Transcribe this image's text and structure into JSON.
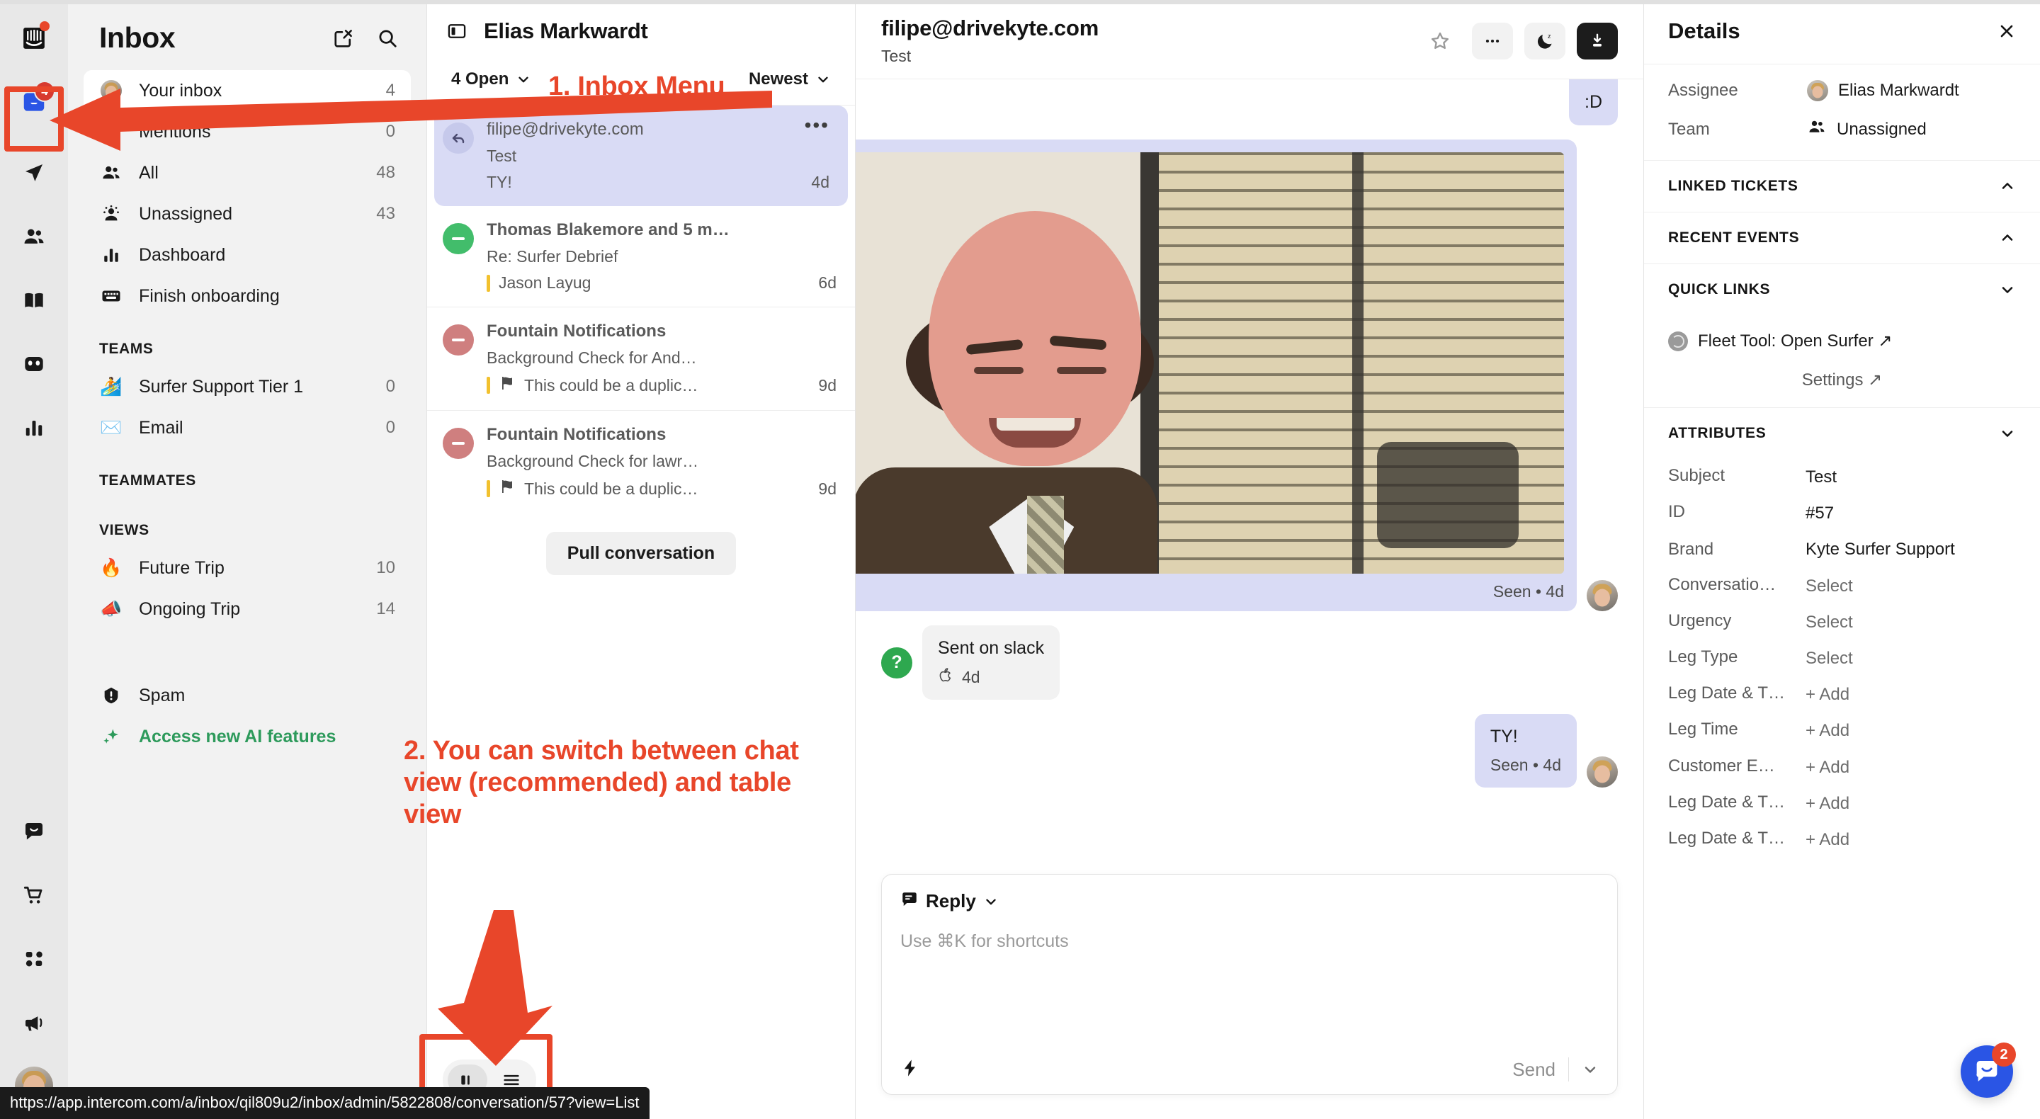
{
  "rail": {
    "icons": [
      {
        "name": "intercom-logo-icon",
        "badge": null,
        "dot": true
      },
      {
        "name": "inbox-icon",
        "badge": "4",
        "active": true
      },
      {
        "name": "send-outbound-icon",
        "badge": null
      },
      {
        "name": "contacts-icon",
        "badge": null
      },
      {
        "name": "knowledge-book-icon",
        "badge": null
      },
      {
        "name": "fin-ai-icon",
        "badge": null
      },
      {
        "name": "reports-bar-chart-icon",
        "badge": null
      },
      {
        "name": "messenger-chat-icon",
        "badge": null
      },
      {
        "name": "commerce-cart-icon",
        "badge": null
      },
      {
        "name": "apps-grid-icon",
        "badge": null
      },
      {
        "name": "news-megaphone-icon",
        "badge": null
      }
    ]
  },
  "nav": {
    "title": "Inbox",
    "compose_icon": "compose-icon",
    "search_icon": "search-icon",
    "items": [
      {
        "label": "Your inbox",
        "count": "4",
        "icon": "avatar",
        "active": true
      },
      {
        "label": "Mentions",
        "count": "0",
        "icon": "at-icon"
      },
      {
        "label": "All",
        "count": "48",
        "icon": "people-icon"
      },
      {
        "label": "Unassigned",
        "count": "43",
        "icon": "unassigned-icon"
      },
      {
        "label": "Dashboard",
        "count": "",
        "icon": "bar-chart-icon"
      },
      {
        "label": "Finish onboarding",
        "count": "",
        "icon": "keyboard-icon"
      }
    ],
    "sections": [
      {
        "title": "TEAMS",
        "items": [
          {
            "label": "Surfer Support Tier 1",
            "count": "0",
            "emoji": "🏄"
          },
          {
            "label": "Email",
            "count": "0",
            "emoji": "✉️"
          }
        ]
      },
      {
        "title": "TEAMMATES",
        "items": []
      },
      {
        "title": "VIEWS",
        "items": [
          {
            "label": "Future Trip",
            "count": "10",
            "emoji": "🔥"
          },
          {
            "label": "Ongoing Trip",
            "count": "14",
            "emoji": "📣"
          }
        ]
      }
    ],
    "footer_items": [
      {
        "label": "Spam",
        "count": "",
        "icon": "spam-icon",
        "style": "normal"
      },
      {
        "label": "Access new AI features",
        "count": "",
        "icon": "sparkle-icon",
        "style": "green"
      }
    ]
  },
  "conv": {
    "header_title": "Elias Markwardt",
    "panel_toggle_icon": "panel-toggle-icon",
    "filter_status": "4 Open",
    "filter_sort": "Newest",
    "rows": [
      {
        "name": "filipe@drivekyte.com",
        "subject": "Test",
        "snippet": "TY!",
        "time": "4d",
        "avatar": "reply-arrow",
        "selected": true,
        "has_dots": true,
        "has_bar": false,
        "has_flag": false
      },
      {
        "name": "Thomas Blakemore and 5 m…",
        "subject": "Re: Surfer Debrief",
        "snippet": "Jason Layug",
        "time": "6d",
        "avatar": "green-snooze",
        "selected": false,
        "has_dots": false,
        "has_bar": true,
        "has_flag": false
      },
      {
        "name": "Fountain Notifications",
        "subject": "Background Check for And…",
        "snippet": "This could be a duplic…",
        "time": "9d",
        "avatar": "red-snooze",
        "selected": false,
        "has_dots": false,
        "has_bar": true,
        "has_flag": true
      },
      {
        "name": "Fountain Notifications",
        "subject": "Background Check for lawr…",
        "snippet": "This could be a duplic…",
        "time": "9d",
        "avatar": "red-snooze",
        "selected": false,
        "has_dots": false,
        "has_bar": true,
        "has_flag": true
      }
    ],
    "pull_button": "Pull conversation",
    "view_toggle": {
      "chat_icon": "chat-view-icon",
      "table_icon": "table-view-icon",
      "active": "chat"
    }
  },
  "main": {
    "title": "filipe@drivekyte.com",
    "subtitle": "Test",
    "actions": [
      {
        "name": "star-icon",
        "label": "Star"
      },
      {
        "name": "more-options-icon",
        "label": "•••"
      },
      {
        "name": "snooze-moon-icon",
        "label": "Snooze"
      },
      {
        "name": "close-conversation-icon",
        "label": "Close"
      }
    ],
    "messages": [
      {
        "type": "text",
        "text": ":D",
        "side": "right",
        "clipped_top": true
      },
      {
        "type": "image",
        "side": "right",
        "meta": "Seen • 4d",
        "alt": "Kevin Malone smiling meme"
      },
      {
        "type": "note",
        "text": "Sent on slack",
        "side": "left",
        "meta_icon": "apple-icon",
        "meta": "4d"
      },
      {
        "type": "text",
        "text": "TY!",
        "side": "right",
        "meta": "Seen • 4d"
      }
    ],
    "composer": {
      "mode_icon": "reply-note-icon",
      "mode_label": "Reply",
      "placeholder": "Use ⌘K for shortcuts",
      "lightning_icon": "lightning-macro-icon",
      "send_label": "Send",
      "send_caret": "chevron-down-icon"
    }
  },
  "details": {
    "title": "Details",
    "close_icon": "close-icon",
    "rows": [
      {
        "label": "Assignee",
        "value": "Elias Markwardt",
        "icon": "avatar"
      },
      {
        "label": "Team",
        "value": "Unassigned",
        "icon": "people-icon"
      }
    ],
    "sections": [
      {
        "title": "LINKED TICKETS",
        "state": "expanded",
        "chevron": "chevron-up-icon"
      },
      {
        "title": "RECENT EVENTS",
        "state": "expanded",
        "chevron": "chevron-up-icon"
      },
      {
        "title": "QUICK LINKS",
        "state": "collapsed",
        "chevron": "chevron-down-icon"
      }
    ],
    "quick_links": [
      {
        "label": "Fleet Tool: Open Surfer ↗",
        "icon": "globe-icon"
      }
    ],
    "settings_link": "Settings ↗",
    "attributes_title": "ATTRIBUTES",
    "attributes_chevron": "chevron-down-icon",
    "attributes": [
      {
        "label": "Subject",
        "value": "Test",
        "muted": false
      },
      {
        "label": "ID",
        "value": "#57",
        "muted": false
      },
      {
        "label": "Brand",
        "value": "Kyte Surfer Support",
        "muted": false
      },
      {
        "label": "Conversatio…",
        "value": "Select",
        "muted": true
      },
      {
        "label": "Urgency",
        "value": "Select",
        "muted": true
      },
      {
        "label": "Leg Type",
        "value": "Select",
        "muted": true
      },
      {
        "label": "Leg Date & T…",
        "value": "+ Add",
        "muted": true
      },
      {
        "label": "Leg Time",
        "value": "+ Add",
        "muted": true
      },
      {
        "label": "Customer E…",
        "value": "+ Add",
        "muted": true
      },
      {
        "label": "Leg Date & T…",
        "value": "+ Add",
        "muted": true
      },
      {
        "label": "Leg Date & T…",
        "value": "+ Add",
        "muted": true
      }
    ]
  },
  "annotations": {
    "one": "1. Inbox Menu",
    "two": "2. You can switch between chat view (recommended) and table view",
    "color": "#E8462A"
  },
  "status_url": "https://app.intercom.com/a/inbox/qil809u2/inbox/admin/5822808/conversation/57?view=List",
  "launcher": {
    "badge": "2",
    "icon": "messenger-icon"
  }
}
